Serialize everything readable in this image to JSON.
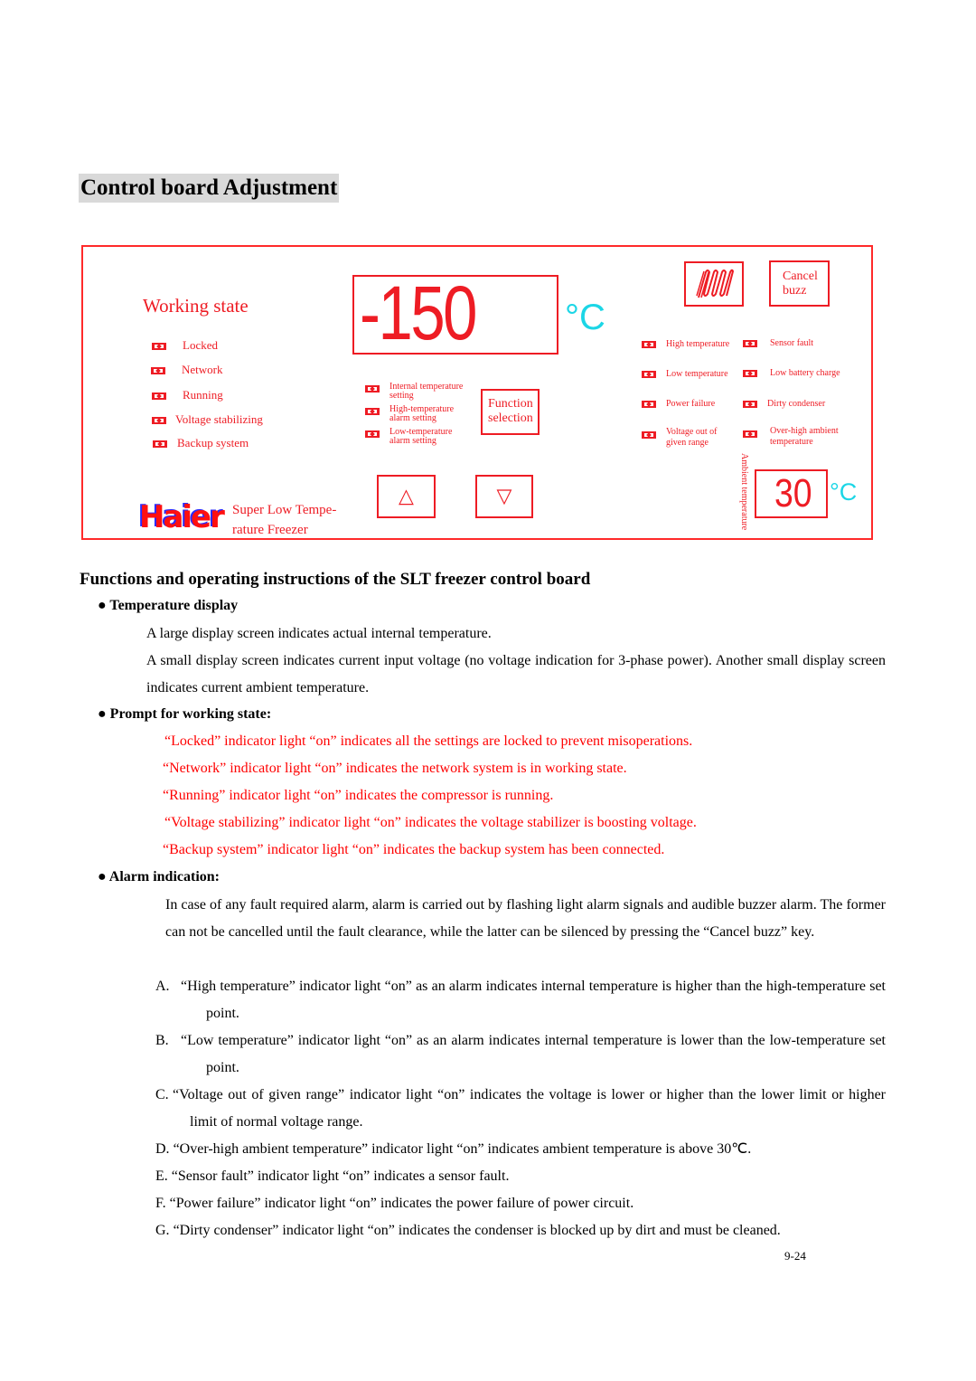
{
  "page": {
    "title": "Control board Adjustment",
    "page_number": "9-24"
  },
  "control_board": {
    "working_state": {
      "title": "Working state",
      "items": [
        "Locked",
        "Network",
        "Running",
        "Voltage stabilizing",
        "Backup system"
      ]
    },
    "main_display": {
      "value": "-150",
      "unit": "°C"
    },
    "settings_indicators": [
      {
        "line1": "Internal temperature",
        "line2": "setting"
      },
      {
        "line1": "High-temperature",
        "line2": "alarm setting"
      },
      {
        "line1": "Low-temperature",
        "line2": "alarm setting"
      }
    ],
    "buttons": {
      "function_selection": {
        "line1": "Function",
        "line2": "selection"
      },
      "cancel_buzz": {
        "line1": "Cancel",
        "line2": "buzz"
      },
      "up": "△",
      "down": "▽"
    },
    "alarm_indicators": {
      "left": [
        {
          "line1": "High temperature",
          "line2": ""
        },
        {
          "line1": "Low temperature",
          "line2": ""
        },
        {
          "line1": "Power failure",
          "line2": ""
        },
        {
          "line1": "Voltage out of",
          "line2": "given range"
        }
      ],
      "right": [
        {
          "line1": "Sensor fault",
          "line2": ""
        },
        {
          "line1": "Low battery charge",
          "line2": ""
        },
        {
          "line1": "Dirty condenser",
          "line2": ""
        },
        {
          "line1": "Over-high ambient",
          "line2": "temperature"
        }
      ]
    },
    "ambient": {
      "label": "Ambient temperature",
      "value": "30",
      "unit": "°C"
    },
    "brand": {
      "logo": "Haier",
      "product_line1": "Super Low Tempe-",
      "product_line2": "rature Freezer"
    },
    "colors": {
      "panel_red": "#ee1c24",
      "unit_cyan": "#1cd6e6",
      "logo_blue": "#2a2aff"
    }
  },
  "content": {
    "heading": "Functions and operating instructions of the SLT freezer control board",
    "temperature_display": {
      "title": "● Temperature display",
      "lines": [
        "A large display screen indicates actual internal temperature.",
        "A small display screen indicates current input voltage (no voltage indication for 3-phase power). Another small display screen indicates current ambient temperature."
      ]
    },
    "working_state_prompt": {
      "title": "● Prompt for working state:",
      "lines": [
        "“Locked” indicator light “on” indicates all the settings are locked to prevent misoperations.",
        "“Network” indicator light “on” indicates the network system is in working state.",
        "“Running” indicator light “on” indicates the compressor is running.",
        "“Voltage stabilizing” indicator light “on” indicates the voltage stabilizer is boosting voltage.",
        "“Backup system” indicator light “on” indicates the backup system has been connected."
      ]
    },
    "alarm_indication": {
      "title": "● Alarm indication:",
      "intro": "In case of any fault required alarm, alarm is carried out by flashing light alarm signals and audible buzzer alarm. The former can not be cancelled until the fault clearance, while the latter can be silenced by pressing the “Cancel buzz” key.",
      "items": [
        {
          "marker": "A.",
          "text": "“High temperature” indicator light “on” as an alarm indicates internal temperature is higher than the high-temperature set point."
        },
        {
          "marker": "B.",
          "text": "“Low temperature” indicator light “on” as an alarm indicates internal temperature is lower than the low-temperature set point."
        },
        {
          "marker": "C.",
          "text": "“Voltage out of given range” indicator light “on” indicates the voltage is lower or higher than the lower limit or higher limit of normal voltage range."
        },
        {
          "marker": "D.",
          "text": "“Over-high ambient temperature” indicator light “on” indicates ambient temperature is above 30℃."
        },
        {
          "marker": "E.",
          "text": "“Sensor fault” indicator light “on” indicates a sensor fault."
        },
        {
          "marker": "F.",
          "text": "“Power failure” indicator light “on” indicates the power failure of power circuit."
        },
        {
          "marker": "G.",
          "text": "“Dirty condenser” indicator light “on” indicates the condenser is blocked up by dirt and must be cleaned."
        }
      ]
    }
  }
}
